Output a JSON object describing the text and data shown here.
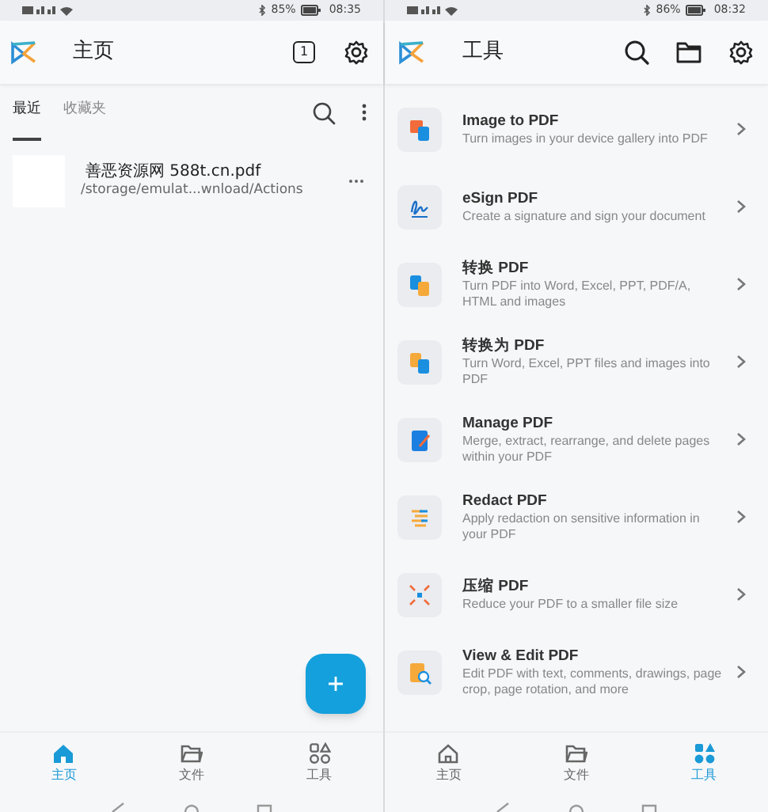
{
  "home_screen": {
    "status_bar": {
      "battery": "85%",
      "time": "08:35"
    },
    "app_bar": {
      "title": "主页",
      "tab_count": "1"
    },
    "tabs": [
      {
        "label": "最近",
        "selected": true
      },
      {
        "label": "收藏夹",
        "selected": false
      }
    ],
    "files": [
      {
        "name": "善恶资源网 588t.cn.pdf",
        "path": "/storage/emulat...wnload/Actions"
      }
    ],
    "bottom_nav": [
      {
        "label": "主页",
        "selected": true
      },
      {
        "label": "文件",
        "selected": false
      },
      {
        "label": "工具",
        "selected": false
      }
    ]
  },
  "tools_screen": {
    "status_bar": {
      "battery": "86%",
      "time": "08:32"
    },
    "app_bar": {
      "title": "工具"
    },
    "tools": [
      {
        "title": "Image to PDF",
        "description": "Turn images in your device gallery into PDF"
      },
      {
        "title": "eSign PDF",
        "description": "Create a signature and sign your document"
      },
      {
        "title": "转换 PDF",
        "description": "Turn PDF into Word, Excel, PPT, PDF/A, HTML and images"
      },
      {
        "title": "转换为 PDF",
        "description": "Turn Word, Excel, PPT files and images into PDF"
      },
      {
        "title": "Manage PDF",
        "description": "Merge, extract, rearrange, and delete pages within your PDF"
      },
      {
        "title": "Redact PDF",
        "description": "Apply redaction on sensitive information in your PDF"
      },
      {
        "title": "压缩 PDF",
        "description": "Reduce your PDF to a smaller file size"
      },
      {
        "title": "View & Edit PDF",
        "description": "Edit PDF with text, comments, drawings, page crop, page rotation, and more"
      }
    ],
    "bottom_nav": [
      {
        "label": "主页",
        "selected": false
      },
      {
        "label": "文件",
        "selected": false
      },
      {
        "label": "工具",
        "selected": true
      }
    ]
  }
}
